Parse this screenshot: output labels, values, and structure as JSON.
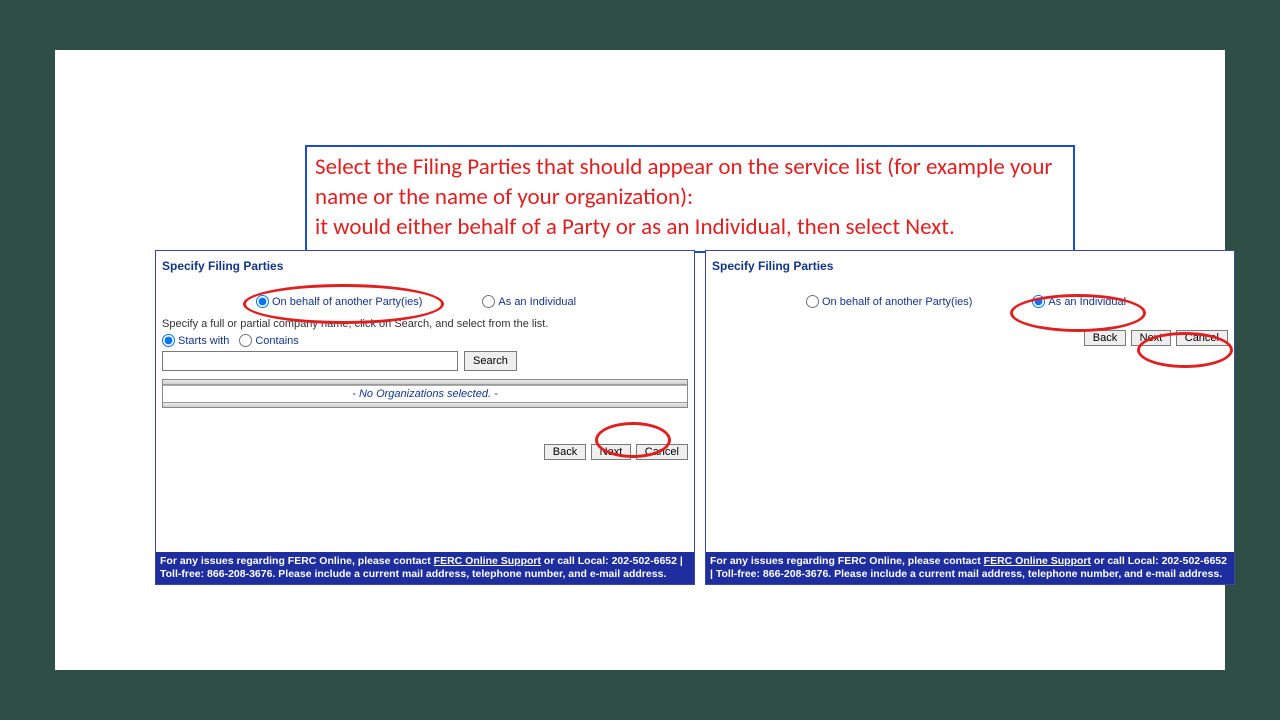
{
  "instruction": {
    "line1": "Select the Filing Parties that should appear on the service list (for example your name or the name of your organization):",
    "line2": "it would either behalf of a Party or as an Individual, then select Next."
  },
  "panel": {
    "title": "Specify Filing Parties",
    "option_party": "On behalf of another Party(ies)",
    "option_individual": "As an Individual",
    "search_hint": "Specify a full or partial company name, click on Search, and select from the list.",
    "starts_with": "Starts with",
    "contains": "Contains",
    "search_btn": "Search",
    "org_empty": "- No Organizations selected. -",
    "back": "Back",
    "next": "Next",
    "cancel": "Cancel"
  },
  "footer": {
    "pre": "For any issues regarding FERC Online, please contact ",
    "link": "FERC Online Support",
    "post": " or call Local: 202-502-6652 | Toll-free: 866-208-3676. Please include a current mail address, telephone number, and e-mail address."
  }
}
